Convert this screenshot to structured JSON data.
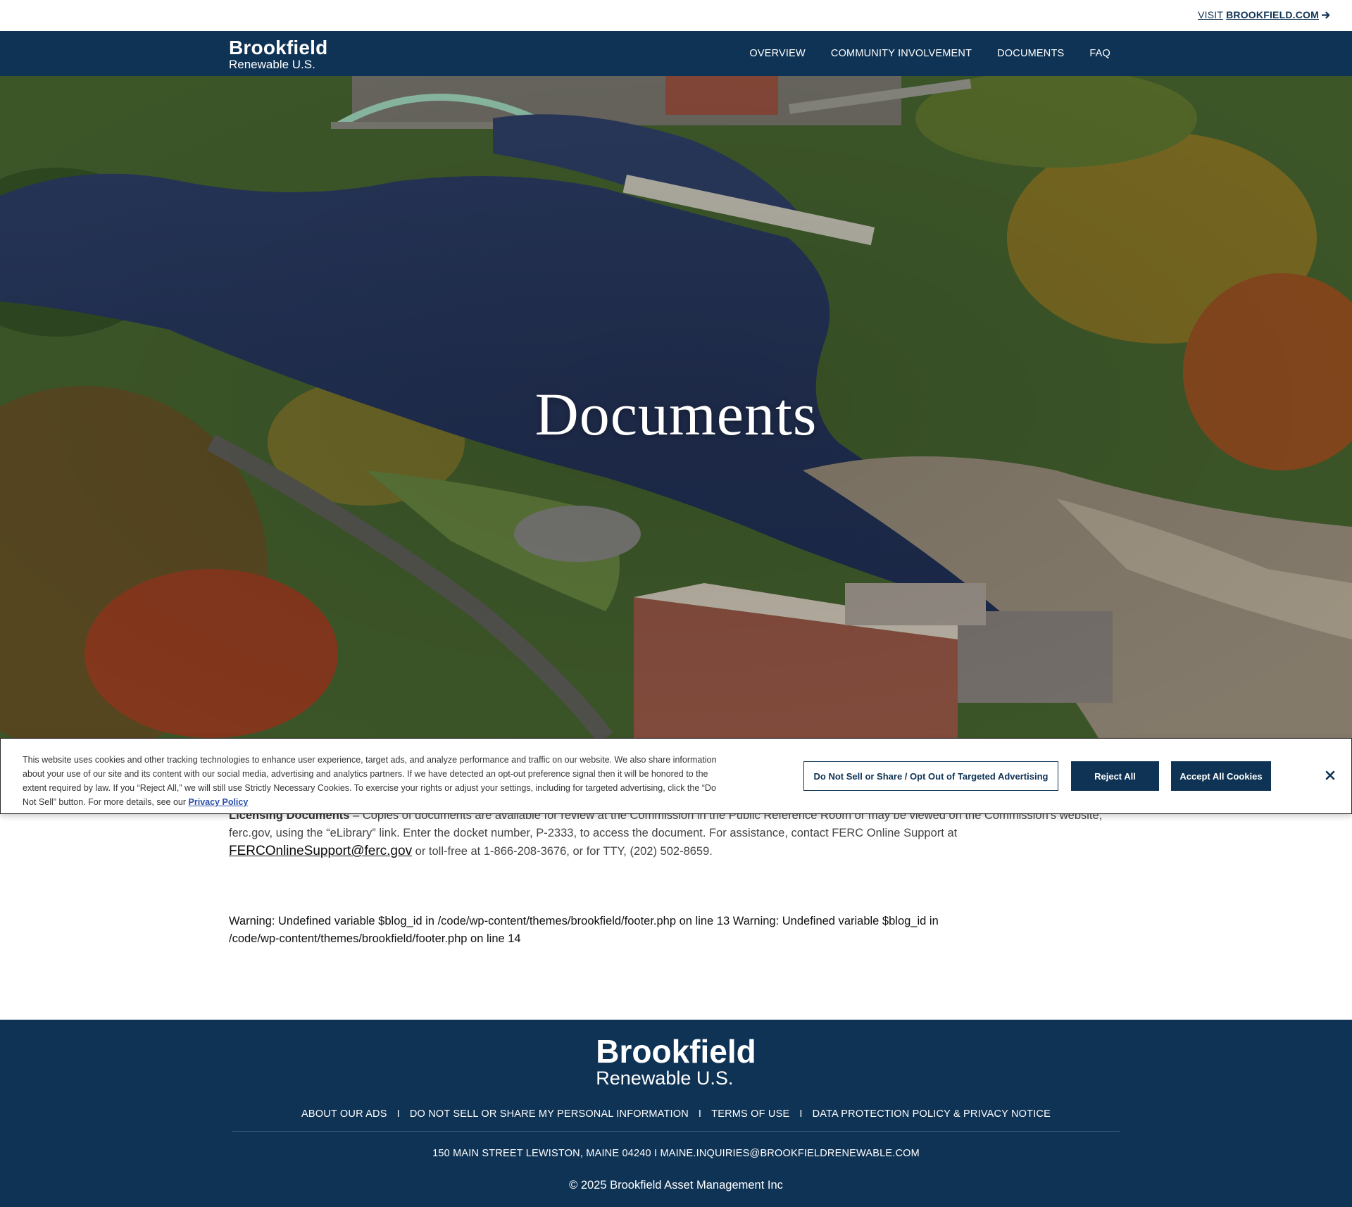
{
  "topbar": {
    "visit_prefix": "VISIT ",
    "visit_site": "BROOKFIELD.COM"
  },
  "header": {
    "logo_line1": "Brookfield",
    "logo_line2": "Renewable U.S.",
    "nav": [
      "OVERVIEW",
      "COMMUNITY INVOLVEMENT",
      "DOCUMENTS",
      "FAQ"
    ]
  },
  "hero": {
    "title": "Documents"
  },
  "content": {
    "heading": "Licensing Documents",
    "dash": " – ",
    "body1": "Copies of documents are available for review at the Commission in the Public Reference Room or may be viewed on the Commission's website, ferc.gov, using the “eLibrary” link.  Enter the docket number, P-2333, to access the document. For assistance, contact FERC Online Support at ",
    "email": "FERCOnlineSupport@ferc.gov",
    "body2": " or toll-free at 1-866-208-3676, or for TTY, (202) 502-8659.",
    "warning": "Warning: Undefined variable $blog_id in /code/wp-content/themes/brookfield/footer.php on line 13 Warning: Undefined variable $blog_id in /code/wp-content/themes/brookfield/footer.php on line 14"
  },
  "cookie": {
    "text": "This website uses cookies and other tracking technologies to enhance user experience, target ads, and analyze performance and traffic on our website. We also share information about your use of our site and its content with our social media, advertising and analytics partners. If we have detected an opt-out preference signal then it will be honored to the extent required by law. If you “Reject All,” we will still use Strictly Necessary Cookies. To exercise your rights or adjust your settings, including for targeted advertising, click the “Do Not Sell” button. For more details, see our ",
    "privacy_link": "Privacy Policy",
    "btn_opt_out": "Do Not Sell or Share / Opt Out of Targeted Advertising",
    "btn_reject": "Reject All",
    "btn_accept": "Accept All Cookies"
  },
  "footer": {
    "logo_line1": "Brookfield",
    "logo_line2": "Renewable U.S.",
    "links": [
      "ABOUT OUR ADS",
      "DO NOT SELL OR SHARE MY PERSONAL INFORMATION",
      "TERMS OF USE",
      "DATA PROTECTION POLICY & PRIVACY NOTICE"
    ],
    "separator": "I",
    "address": "150 MAIN STREET LEWISTON, MAINE 04240 I MAINE.INQUIRIES@BROOKFIELDRENEWABLE.COM",
    "copyright": "© 2025 Brookfield Asset Management Inc"
  },
  "colors": {
    "brand_navy": "#0f3355",
    "link_blue": "#2a4fa8"
  }
}
